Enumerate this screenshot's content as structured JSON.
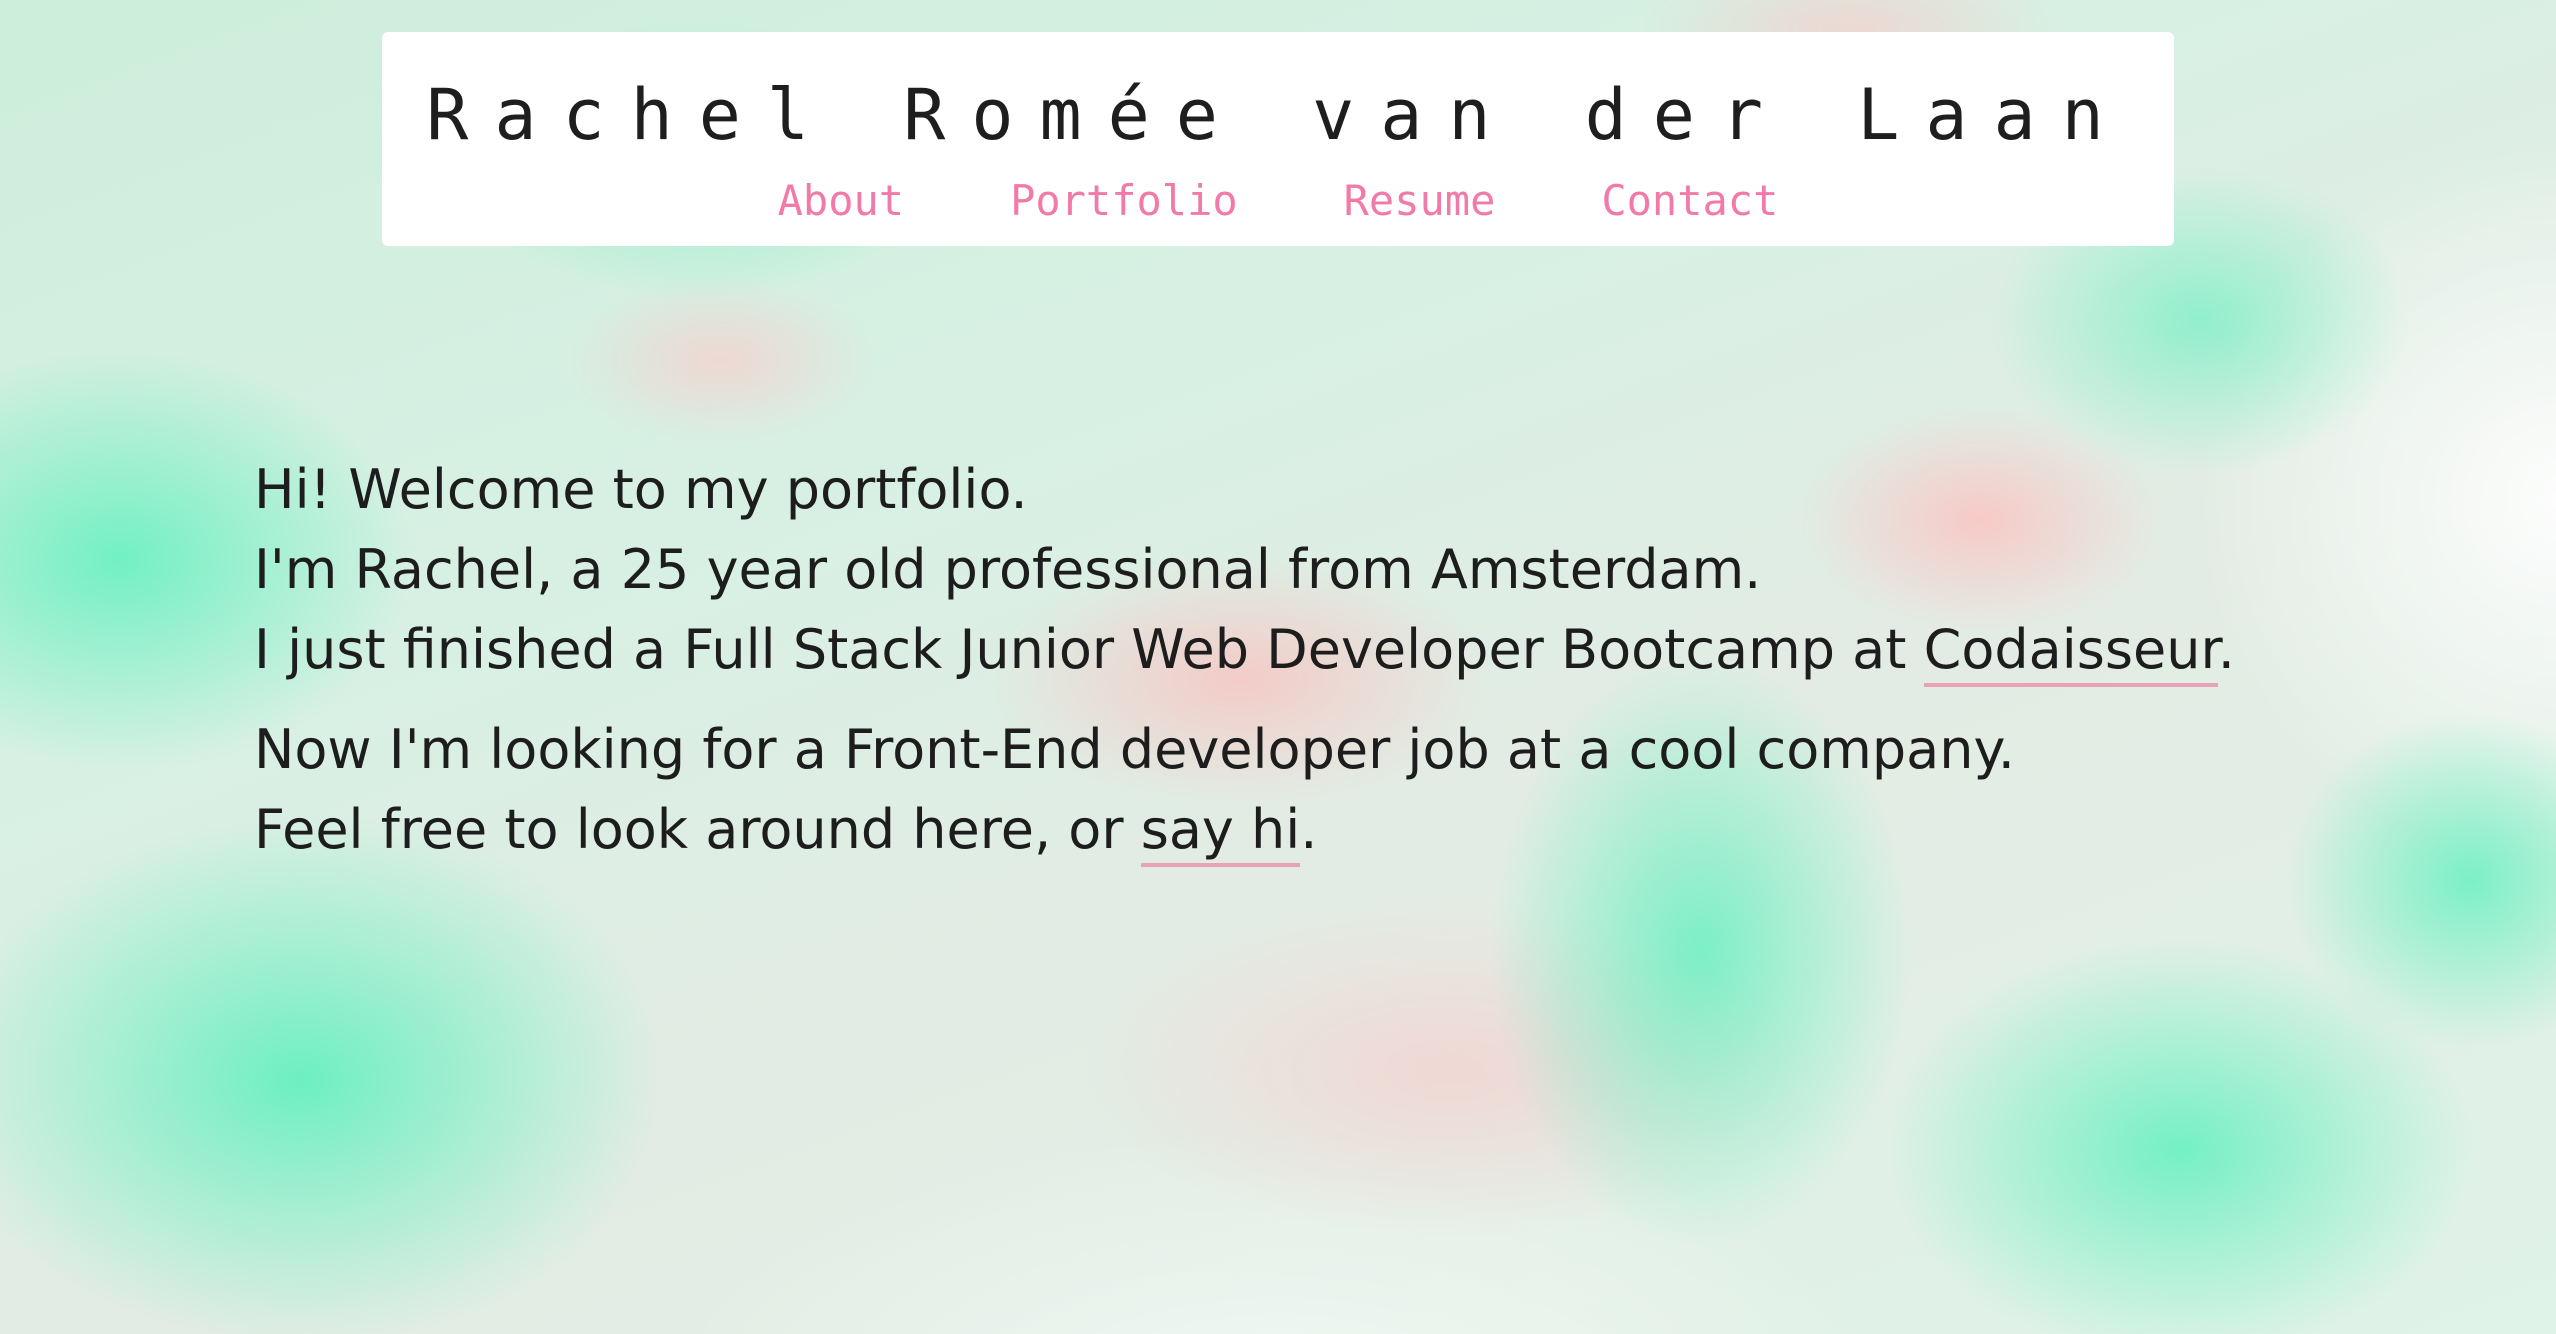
{
  "header": {
    "title": "Rachel Romée van der Laan",
    "nav": [
      {
        "label": "About"
      },
      {
        "label": "Portfolio"
      },
      {
        "label": "Resume"
      },
      {
        "label": "Contact"
      }
    ]
  },
  "intro": {
    "line1": "Hi! Welcome to my portfolio.",
    "line2": "I'm Rachel, a 25 year old professional from Amsterdam.",
    "line3_text": "I just finished a Full Stack Junior Web Developer Bootcamp at ",
    "line3_link": "Codaisseur",
    "line3_end": ".",
    "line4": "Now I'm looking for a Front-End developer job at a cool company.",
    "line5_text": "Feel free to look around here, or ",
    "line5_link": "say hi",
    "line5_end": "."
  },
  "colors": {
    "nav_link": "#f27aa8",
    "link_underline": "#e7a2b8",
    "background_mint": "#50f0b9",
    "background_pink": "#ffbebe",
    "text": "#1d1d1d"
  }
}
